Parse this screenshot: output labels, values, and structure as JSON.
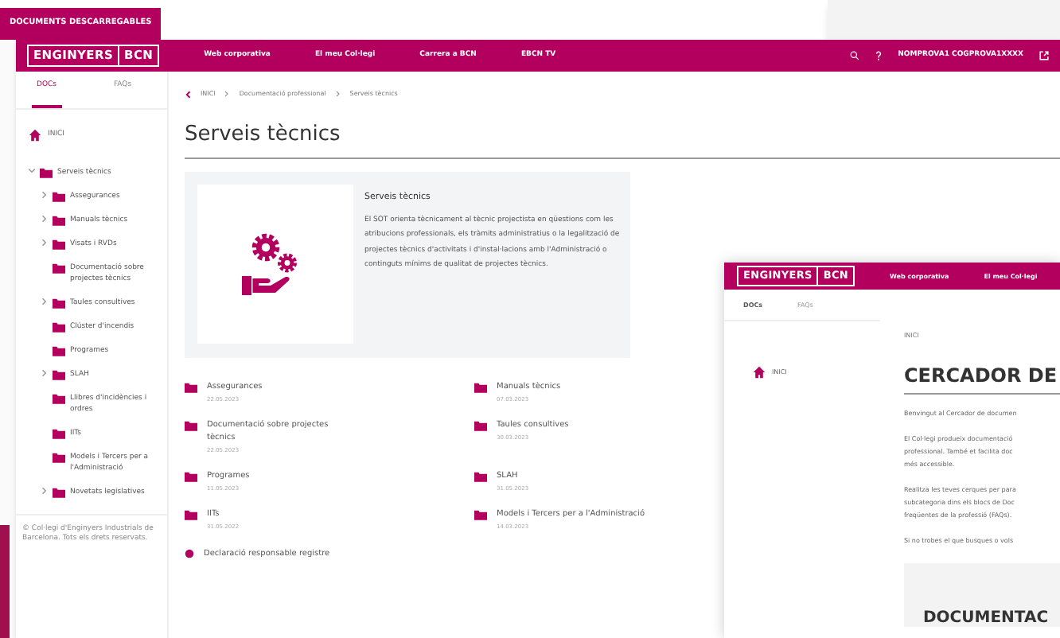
{
  "badge": "DOCUMENTS DESCARREGABLES",
  "main": {
    "logo": [
      "ENGINYERS",
      "BCN"
    ],
    "nav": [
      "Web corporativa",
      "El meu Col·legi",
      "Carrera a BCN",
      "EBCN TV"
    ],
    "user": "NOMPROVA1 COGPROVA1XXXX",
    "tabs": [
      {
        "label": "DOCs",
        "selected": true
      },
      {
        "label": "FAQs",
        "selected": false
      }
    ],
    "sidebar": {
      "home": "INICI",
      "tree": [
        {
          "label": "Serveis tècnics",
          "expanded": true,
          "children": [
            {
              "label": "Assegurances",
              "expanded": false
            },
            {
              "label": "Manuals tècnics",
              "expanded": false
            },
            {
              "label": "Visats i RVDs",
              "expanded": false
            },
            {
              "label": "Documentació sobre projectes tècnics"
            },
            {
              "label": "Taules consultives",
              "expanded": false
            },
            {
              "label": "Clúster d'incendis"
            },
            {
              "label": "Programes"
            },
            {
              "label": "SLAH",
              "expanded": false
            },
            {
              "label": "Llibres d'incidències i ordres"
            },
            {
              "label": "IITs"
            },
            {
              "label": "Models i Tercers per a l'Administració"
            },
            {
              "label": "Novetats legislatives",
              "expanded": false
            }
          ]
        }
      ],
      "footer": "© Col·legi d'Enginyers Industrials de Barcelona. Tots els drets reservats."
    },
    "breadcrumb": [
      "INICI",
      "Documentació professional",
      "Serveis tècnics"
    ],
    "title": "Serveis tècnics",
    "intro": {
      "title": "Serveis tècnics",
      "text": "El SOT orienta tècnicament al tècnic projectista en qüestions com les atribucions professionals, els tràmits administratius o la legalització de projectes tècnics d'activitats i d'instal·lacions amb l'Administració o continguts mínims de qualitat de projectes tècnics."
    },
    "documents": [
      {
        "kind": "folder",
        "name": "Assegurances",
        "date": "22.05.2023"
      },
      {
        "kind": "folder",
        "name": "Manuals tècnics",
        "date": "07.03.2023"
      },
      {
        "kind": "folder",
        "name": "Documentació sobre projectes tècnics",
        "date": "22.05.2023"
      },
      {
        "kind": "folder",
        "name": "Taules consultives",
        "date": "30.03.2023"
      },
      {
        "kind": "folder",
        "name": "Programes",
        "date": "11.05.2023"
      },
      {
        "kind": "folder",
        "name": "SLAH",
        "date": "31.05.2023"
      },
      {
        "kind": "folder",
        "name": "IITs",
        "date": "31.05.2022"
      },
      {
        "kind": "folder",
        "name": "Models i Tercers per a l'Administració",
        "date": "14.03.2023"
      },
      {
        "kind": "file",
        "name": "Declaració responsable registre"
      }
    ]
  },
  "second": {
    "logo": [
      "ENGINYERS",
      "BCN"
    ],
    "nav": [
      "Web corporativa",
      "El meu Col·legi"
    ],
    "tabs": [
      {
        "label": "DOCs",
        "selected": true
      },
      {
        "label": "FAQs",
        "selected": false
      }
    ],
    "home": "INICI",
    "breadcrumb": [
      "INICI"
    ],
    "title": "CERCADOR DE",
    "paragraphs": [
      [
        "Benvingut al Cercador de documen"
      ],
      [
        "El Col·legi produeix documentació",
        "professional. També et facilita doc",
        "més accessible."
      ],
      [
        "Realitza les teves cerques per para",
        "subcategoria dins els blocs de Doc",
        "freqüentes de la professió (FAQs)."
      ],
      [
        "Si no trobes el que busques o vols"
      ]
    ],
    "section": "DOCUMENTAC"
  }
}
